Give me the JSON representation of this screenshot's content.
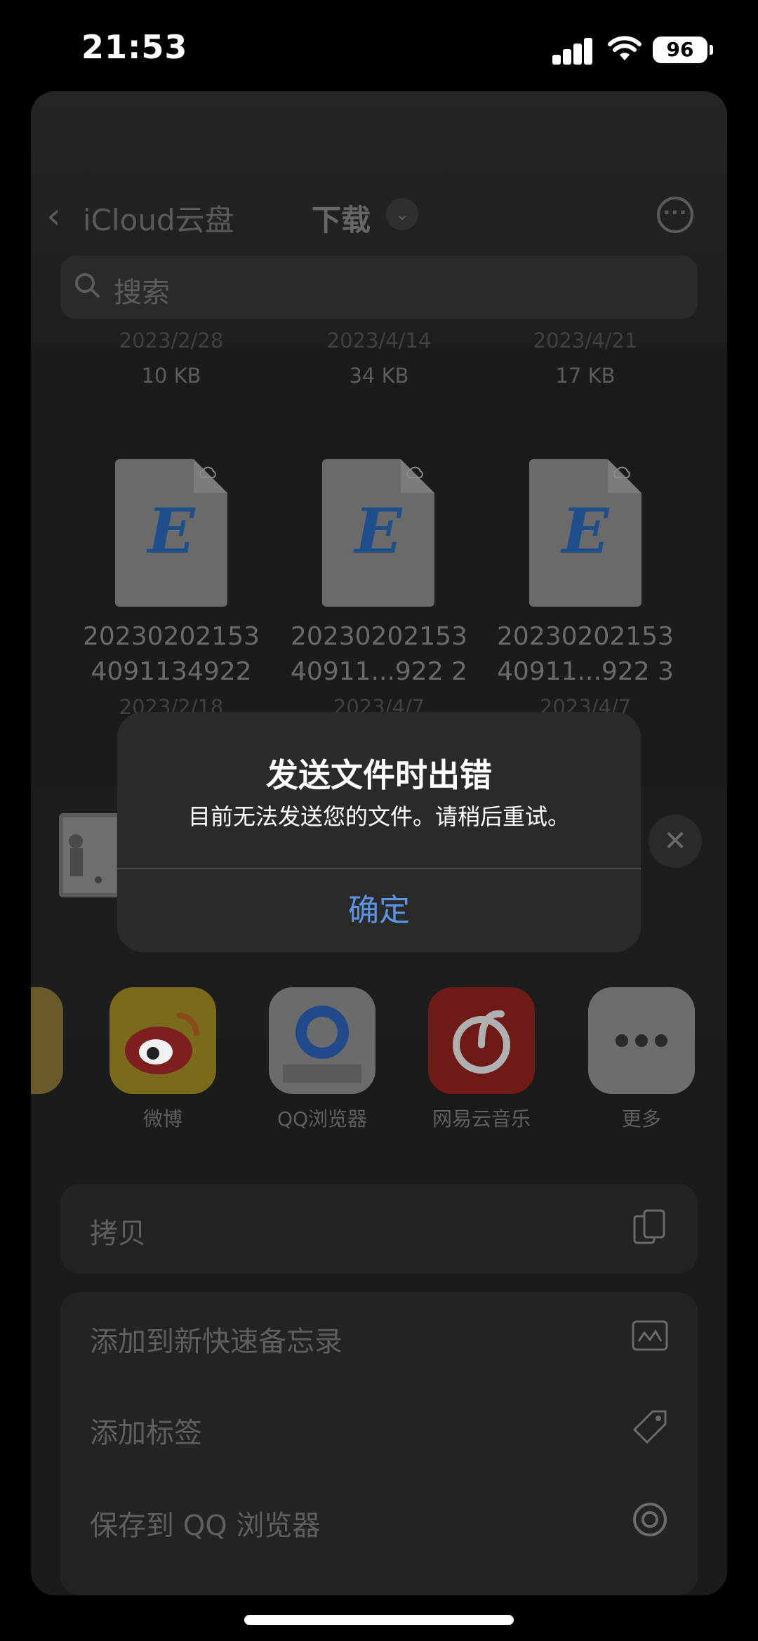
{
  "status": {
    "time": "21:53",
    "battery": "96"
  },
  "nav": {
    "back_label": "iCloud云盘",
    "title": "下载",
    "chevron": "⌄",
    "more": "···"
  },
  "search": {
    "placeholder": "搜索"
  },
  "top_row_files": [
    {
      "date": "2023/2/28",
      "size": "10 KB"
    },
    {
      "date": "2023/4/14",
      "size": "34 KB"
    },
    {
      "date": "2023/4/21",
      "size": "17 KB"
    }
  ],
  "files": [
    {
      "name_line1": "20230202153",
      "name_line2": "4091134922",
      "date": "2023/2/18",
      "icon_letter": "E"
    },
    {
      "name_line1": "20230202153",
      "name_line2": "40911...922 2",
      "date": "2023/4/7",
      "icon_letter": "E"
    },
    {
      "name_line1": "20230202153",
      "name_line2": "40911...922 3",
      "date": "2023/4/7",
      "icon_letter": "E"
    }
  ],
  "share_close": "✕",
  "apps": [
    {
      "label": "微博",
      "icon": "weibo-icon",
      "bg": "#7a6a1c"
    },
    {
      "label": "QQ浏览器",
      "icon": "qq-browser-icon",
      "bg": "#6b6b6b"
    },
    {
      "label": "网易云音乐",
      "icon": "netease-music-icon",
      "bg": "#6e1a16"
    },
    {
      "label": "更多",
      "icon": "more-icon",
      "bg": "#6d6d6d"
    }
  ],
  "actions": {
    "copy": "拷贝",
    "quick_note": "添加到新快速备忘录",
    "add_tag": "添加标签",
    "save_qq": "保存到 QQ 浏览器"
  },
  "alert": {
    "title": "发送文件时出错",
    "message": "目前无法发送您的文件。请稍后重试。",
    "ok": "确定"
  },
  "colors": {
    "alert_bg": "#2a2a2a",
    "link_blue": "#5d93e0"
  }
}
